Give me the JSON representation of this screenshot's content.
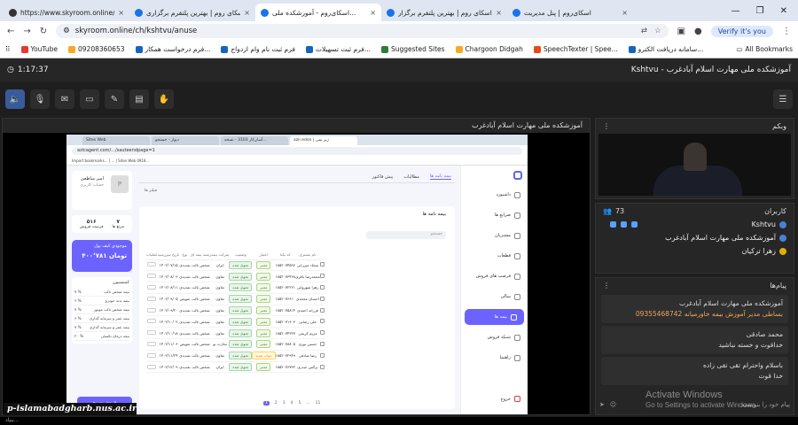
{
  "browser": {
    "tabs": [
      {
        "label": "https://www.skyroom.online/ch/s",
        "active": false
      },
      {
        "label": "اسکای روم | بهترین پلتفرم برگزاری",
        "active": false
      },
      {
        "label": "اسکای‌روم - آموزشکده ملی...",
        "active": true
      },
      {
        "label": "اسکای روم | بهترین پلتفرم برگزار",
        "active": false
      },
      {
        "label": "اسکای‌روم | پنل مدیریت",
        "active": false
      }
    ],
    "url": "skyroom.online/ch/kshtvu/anuse",
    "verify_label": "Verify it's you",
    "bookmarks": [
      {
        "label": "YouTube",
        "color": "#e53935"
      },
      {
        "label": "09208360653",
        "color": "#f9a825"
      },
      {
        "label": "فرم درخواست همکار...",
        "color": "#1565c0"
      },
      {
        "label": "فرم ثبت نام وام ازدواج",
        "color": "#1565c0"
      },
      {
        "label": "فرم ثبت تسهیلات...",
        "color": "#1565c0"
      },
      {
        "label": "Suggested Sites",
        "color": "#2e7d32"
      },
      {
        "label": "Chargoon Didgah",
        "color": "#f9a825"
      },
      {
        "label": "SpeechTexter | Spee...",
        "color": "#e64a19"
      },
      {
        "label": "سامانه دریافت الکترو...",
        "color": "#1565c0"
      }
    ],
    "all_bookmarks": "All Bookmarks"
  },
  "app": {
    "timer": "1:17:37",
    "room_title": "Kshtvu - آموزشکده ملی مهارت اسلام آبادغرب",
    "main_panel_title": "آموزشکده ملی مهارت اسلام آبادغرب"
  },
  "shared": {
    "tabs": [
      "Sitex Web",
      "دیوار - جستجو",
      "آسان‌کار 3103 - نسخه...",
      "azir.edon | زیر نمی"
    ],
    "url": "azicagent.com/.../sauteendpage=1",
    "bookmarks": "Import bookmarks... | ... | Sitex Web 0918...",
    "nav": [
      "داشبورد",
      "صرایع ها",
      "مشتریان",
      "قطعات",
      "فرصت های فروش",
      "سالی",
      "بیمه ها",
      "شبکه فروش",
      "راهنما"
    ],
    "active_nav": "بیمه ها",
    "exit": "خروج",
    "profile": {
      "name": "امیر ساطعی",
      "role": "حساب کاربری"
    },
    "stats": [
      {
        "value": "۵۱۶",
        "label": "فرصت فروش"
      },
      {
        "value": "۷",
        "label": "مرتع ها"
      }
    ],
    "wallet": {
      "label": "موجودی کیف پول",
      "amount": "۴۰۰٬۷۸۱ تومان"
    },
    "commission_title": "کمیسیون",
    "commissions": [
      {
        "label": "بیمه شخص ثالث",
        "value": "۷ %"
      },
      {
        "label": "بیمه بدنه خودرو",
        "value": "۶ %"
      },
      {
        "label": "بیمه شخص ثالث موتور",
        "value": "۷ %"
      },
      {
        "label": "بیمه عمر و سرمایه گذاری",
        "value": "۶ %"
      },
      {
        "label": "بیمه عمر و سرمایه گذاری",
        "value": "۷ %"
      },
      {
        "label": "بیمه درمان تکمیلی",
        "value": "۲۰ %"
      }
    ],
    "new_sale_button": "فروش سریع",
    "center_tabs": [
      "بیمه نامه ها",
      "مطالبات",
      "پیش فاکتور"
    ],
    "active_center_tab": "بیمه نامه ها",
    "filter_label": "فیلتر ها",
    "card_title": "بیمه نامه ها",
    "search_placeholder": "جستجو",
    "table_headers": [
      "عملیات",
      "تاریخ سررسید",
      "نوع",
      "رشته بیمه ای",
      "شرکت بیمه",
      "وضعیت",
      "اعتبار",
      "کد یکتا",
      "نام مشتری"
    ],
    "rows": [
      {
        "date": "۱۴۰۲/۰۷/۱۵",
        "type": "تمدیدی",
        "kind": "شخص ثالث",
        "co": "ایران",
        "status": "تحویل شده",
        "credit": "معتبر",
        "code": "۱۸۵۲۰۷۴۵۹۶",
        "name": "سجاد میرزایی"
      },
      {
        "date": "۱۴۰۲/۰۸/۰۳",
        "type": "تمدیدی",
        "kind": "شخص ثالث",
        "co": "تعاون",
        "status": "تحویل شده",
        "credit": "معتبر",
        "code": "۱۸۵۲۰۷۳۴۶۸",
        "name": "محمدرضا باقری"
      },
      {
        "date": "۱۴۰۲/۰۸/۱۱",
        "type": "تمدیدی",
        "kind": "شخص ثالث",
        "co": "تعاون",
        "status": "تحویل شده",
        "credit": "معتبر",
        "code": "۱۸۵۲۰۷۲۲۲۱",
        "name": "زهرا شهروانی"
      },
      {
        "date": "۱۴۰۲/۰۹/۰۵",
        "type": "تعویض",
        "kind": "شخص ثالث",
        "co": "تعاون",
        "status": "تحویل شده",
        "credit": "معتبر",
        "code": "۱۸۵۲۰۷۶۶۱۰",
        "name": "احسان محمدی"
      },
      {
        "date": "۱۴۰۲/۰۹/۲۰",
        "type": "تمدیدی",
        "kind": "شخص ثالث",
        "co": "تعاون",
        "status": "تحویل شده",
        "credit": "معتبر",
        "code": "۱۸۵۲۰۷۵۸۱۴",
        "name": "فرزانه احمدی"
      },
      {
        "date": "۱۴۰۲/۱۰/۰۲",
        "type": "تمدیدی",
        "kind": "شخص ثالث",
        "co": "تعاون",
        "status": "تحویل شده",
        "credit": "معتبر",
        "code": "۱۸۵۲۰۷۱۹۰۳",
        "name": "علی رضایی"
      },
      {
        "date": "۱۴۰۲/۱۰/۱۸",
        "type": "تمدیدی",
        "kind": "شخص ثالث",
        "co": "تعاون",
        "status": "تحویل شده",
        "credit": "معتبر",
        "code": "۱۸۵۲۰۷۴۳۲۷",
        "name": "مریم کریمی"
      },
      {
        "date": "۱۴۰۲/۱۱/۰۶",
        "type": "تعویض",
        "kind": "شخص ثالث",
        "co": "تجارت نو",
        "status": "تحویل شده",
        "credit": "معتبر",
        "code": "۱۸۵۲۰۷۸۸۰۵",
        "name": "حسین نوری"
      },
      {
        "date": "۱۴۰۲/۱۱/۲۴",
        "type": "تمدیدی",
        "kind": "شخص ثالث",
        "co": "تعاون",
        "status": "تحویل شده",
        "credit": "جواب تمدید",
        "code": "۱۸۵۲۰۷۲۹۴۹",
        "name": "رضا صادقی"
      },
      {
        "date": "۱۴۰۲/۱۲/۰۹",
        "type": "تمدیدی",
        "kind": "شخص ثالث",
        "co": "ایران",
        "status": "تحویل شده",
        "credit": "معتبر",
        "code": "۱۸۵۲۰۷۶۷۳۲",
        "name": "نرگس حیدری"
      }
    ],
    "pager": [
      "1",
      "2",
      "3",
      "4",
      "5",
      "...",
      "11"
    ]
  },
  "webcam": {
    "title": "وبکم"
  },
  "users": {
    "title": "کاربران",
    "count": "73",
    "list": [
      {
        "name": "Kshtvu",
        "icon": "blue"
      },
      {
        "name": "آموزشکده ملی مهارت اسلام آبادغرب",
        "icon": "blue"
      },
      {
        "name": "زهرا ترکیان",
        "icon": "yellow"
      }
    ]
  },
  "messages": {
    "title": "پیام‌ها",
    "list": [
      {
        "lines": [
          "آموزشکده ملی مهارت اسلام آبادغرب"
        ],
        "highlight": "09355468742 بساطی مدیر آموزش بیمه خاورمیانه"
      },
      {
        "lines": [
          "محمد صادقی",
          "خداقوت و خسته نباشید"
        ]
      },
      {
        "lines": [
          "باسلام واحترام تقی تقی زاده",
          "خدا قوت"
        ]
      }
    ],
    "input_placeholder": "پیام خود را بنویسید"
  },
  "watermark": "p-islamabadgharb.nus.ac.ir",
  "windows_activation": {
    "line1": "Activate Windows",
    "line2": "Go to Settings to activate Windows."
  },
  "taskbar": "بنیاد..."
}
